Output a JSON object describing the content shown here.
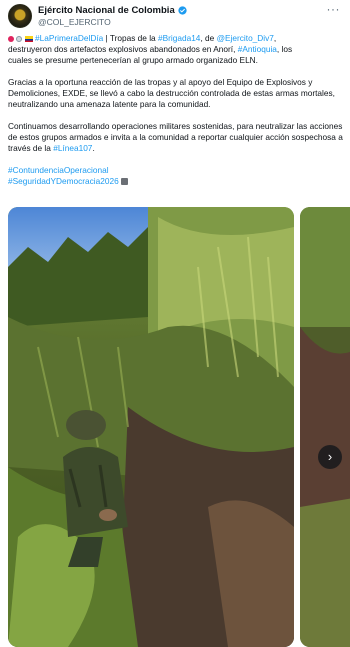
{
  "author": {
    "display_name": "Ejército Nacional de Colombia",
    "handle": "@COL_EJERCITO"
  },
  "tweet": {
    "line1_tag": "#LaPrimeraDelDía",
    "line1_a": " | Tropas de la ",
    "line1_b": "#Brigada14",
    "line1_c": ", de ",
    "line1_d": "@Ejercito_Div7",
    "line1_e": ",",
    "line2_a": "destruyeron dos artefactos explosivos abandonados en Anorí, ",
    "line2_b": "#Antioquia",
    "line2_c": ", los",
    "line3": "cuales se presume pertenecerían al grupo armado organizado ELN.",
    "para2": "Gracias a la oportuna reacción de las tropas y al apoyo del Equipo de Explosivos y Demoliciones, EXDE, se llevó a cabo la destrucción controlada de estas armas mortales, neutralizando una amenaza latente para la comunidad.",
    "para3_a": "Continuamos desarrollando operaciones militares sostenidas, para neutralizar las acciones de estos grupos armados e invita a la comunidad a reportar cualquier acción sospechosa a través de la ",
    "para3_b": "#Línea107",
    "para3_c": ".",
    "hashtag1": "#ContundenciaOperacional",
    "hashtag2": "#SeguridadYDemocracia2026"
  },
  "icons": {
    "verified": "verified-badge-icon",
    "more": "more-options-icon",
    "next": "chevron-right-icon"
  },
  "colors": {
    "link": "#1d9bf0",
    "text": "#0f1419",
    "secondary": "#536471"
  }
}
